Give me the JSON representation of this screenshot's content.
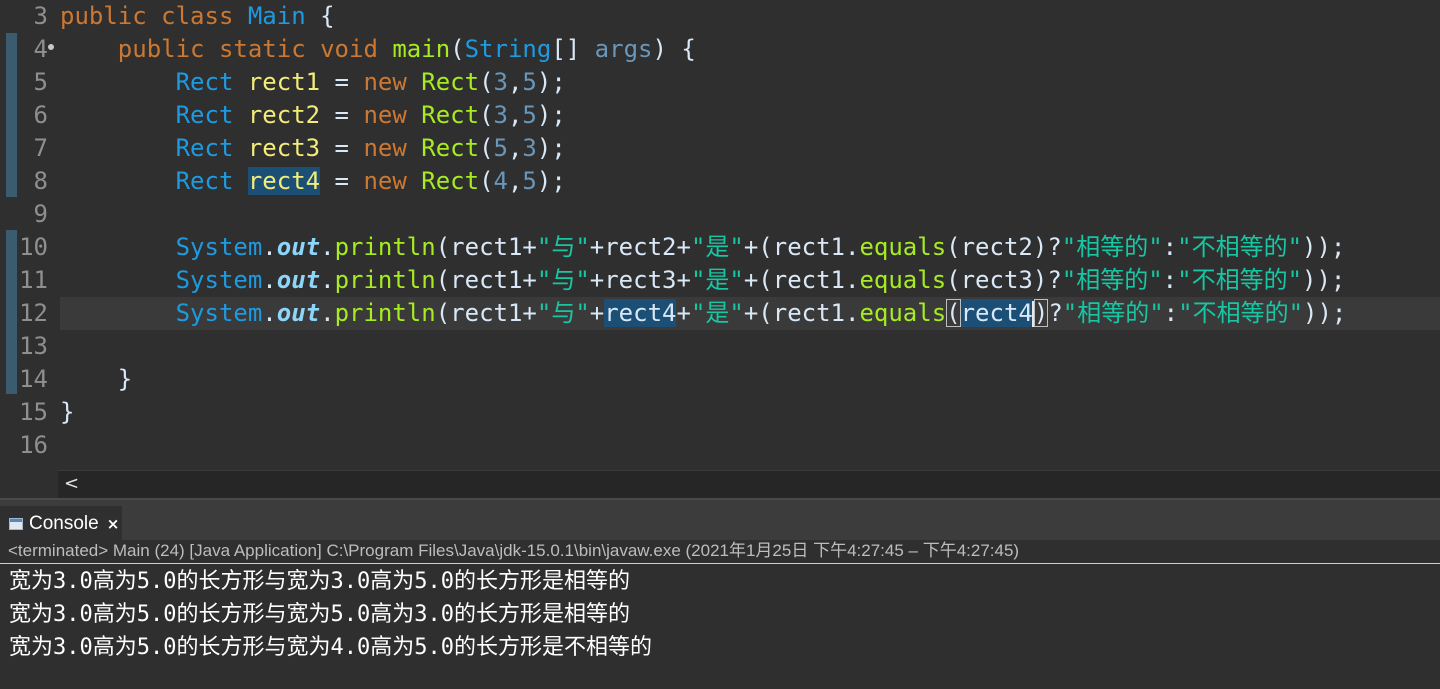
{
  "editor": {
    "line_numbers": [
      "3",
      "4",
      "5",
      "6",
      "7",
      "8",
      "9",
      "10",
      "11",
      "12",
      "13",
      "14",
      "15",
      "16"
    ],
    "code": {
      "l3": {
        "kw1": "public",
        "kw2": "class",
        "name": "Main",
        "brace": " {"
      },
      "l4": {
        "indent": "    ",
        "kw1": "public",
        "kw2": "static",
        "kw3": "void",
        "fn": "main",
        "p1": "(",
        "type": "String",
        "p2": "[] ",
        "arg": "args",
        "p3": ") {"
      },
      "decl": [
        {
          "type": "Rect",
          "var": "rect1",
          "eq": " = ",
          "kw": "new",
          "ctor": "Rect",
          "a": "3",
          "b": "5"
        },
        {
          "type": "Rect",
          "var": "rect2",
          "eq": " = ",
          "kw": "new",
          "ctor": "Rect",
          "a": "3",
          "b": "5"
        },
        {
          "type": "Rect",
          "var": "rect3",
          "eq": " = ",
          "kw": "new",
          "ctor": "Rect",
          "a": "5",
          "b": "3"
        },
        {
          "type": "Rect",
          "var": "rect4",
          "eq": " = ",
          "kw": "new",
          "ctor": "Rect",
          "a": "4",
          "b": "5"
        }
      ],
      "prints": [
        {
          "sys": "System",
          "dot1": ".",
          "out": "out",
          "dot2": ".",
          "fn": "println",
          "p1": "(",
          "r1": "rect1",
          "plus1": "+",
          "s1": "\"与\"",
          "plus2": "+",
          "r2": "rect2",
          "plus3": "+",
          "s2": "\"是\"",
          "plus4": "+(",
          "r3": "rect1",
          "dot3": ".",
          "eq": "equals",
          "p2": "(",
          "r4": "rect2",
          "p3": ")",
          "q": "?",
          "s3": "\"相等的\"",
          "colon": ":",
          "s4": "\"不相等的\"",
          "end": "));"
        },
        {
          "sys": "System",
          "dot1": ".",
          "out": "out",
          "dot2": ".",
          "fn": "println",
          "p1": "(",
          "r1": "rect1",
          "plus1": "+",
          "s1": "\"与\"",
          "plus2": "+",
          "r2": "rect3",
          "plus3": "+",
          "s2": "\"是\"",
          "plus4": "+(",
          "r3": "rect1",
          "dot3": ".",
          "eq": "equals",
          "p2": "(",
          "r4": "rect3",
          "p3": ")",
          "q": "?",
          "s3": "\"相等的\"",
          "colon": ":",
          "s4": "\"不相等的\"",
          "end": "));"
        },
        {
          "sys": "System",
          "dot1": ".",
          "out": "out",
          "dot2": ".",
          "fn": "println",
          "p1": "(",
          "r1": "rect1",
          "plus1": "+",
          "s1": "\"与\"",
          "plus2": "+",
          "r2": "rect4",
          "plus3": "+",
          "s2": "\"是\"",
          "plus4": "+(",
          "r3": "rect1",
          "dot3": ".",
          "eq": "equals",
          "p2": "(",
          "r4": "rect4",
          "p3": ")",
          "q": "?",
          "s3": "\"相等的\"",
          "colon": ":",
          "s4": "\"不相等的\"",
          "end": "));"
        }
      ],
      "l14": "    }",
      "l15": "}"
    },
    "scroll_left_glyph": "<"
  },
  "console": {
    "tab_label": "Console",
    "close_glyph": "×",
    "status": "<terminated> Main (24) [Java Application] C:\\Program Files\\Java\\jdk-15.0.1\\bin\\javaw.exe  (2021年1月25日 下午4:27:45 – 下午4:27:45)",
    "output": [
      "宽为3.0高为5.0的长方形与宽为3.0高为5.0的长方形是相等的",
      "宽为3.0高为5.0的长方形与宽为5.0高为3.0的长方形是相等的",
      "宽为3.0高为5.0的长方形与宽为4.0高为5.0的长方形是不相等的"
    ]
  },
  "colors": {
    "background": "#2f2f2f",
    "keyword": "#cc7832",
    "type": "#1e9ae0",
    "method": "#a7ec21",
    "variable": "#f3ec79",
    "string": "#17c6a3",
    "number": "#6897bb",
    "occurrence_highlight": "#1c4f75"
  }
}
